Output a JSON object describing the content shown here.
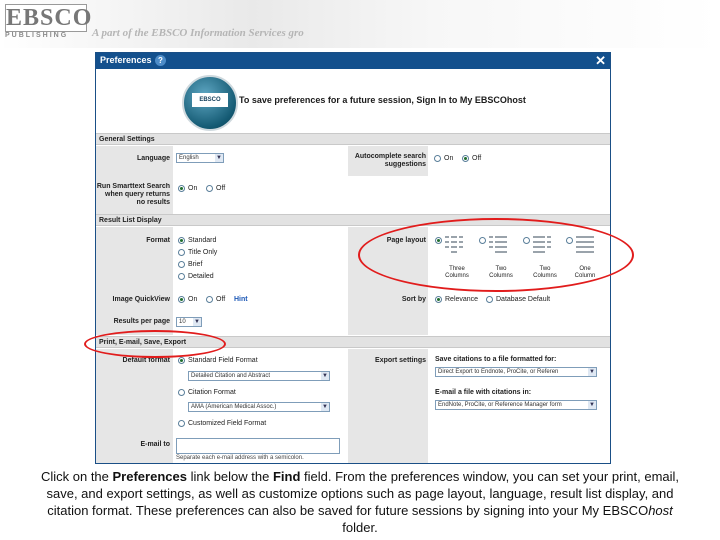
{
  "banner": {
    "logo_text": "EBSCO",
    "logo_sub": "PUBLISHING",
    "tagline": "A part of the EBSCO Information Services gro"
  },
  "dialog": {
    "title": "Preferences",
    "help_icon": "?",
    "close_icon": "✕",
    "signin": {
      "seal_text": "EBSCO",
      "text": "To save preferences for a future session, Sign In to My EBSCOhost"
    },
    "general": {
      "header": "General Settings",
      "language_label": "Language",
      "language_value": "English",
      "autocomplete_label": "Autocomplete search suggestions",
      "autocomplete_on": "On",
      "autocomplete_off": "Off",
      "smarttext_label": "Run Smarttext Search when query returns no results",
      "smarttext_on": "On",
      "smarttext_off": "Off"
    },
    "result_list": {
      "header": "Result List Display",
      "format_label": "Format",
      "formats": [
        "Standard",
        "Title Only",
        "Brief",
        "Detailed"
      ],
      "page_layout_label": "Page layout",
      "layouts": [
        "Three Columns",
        "Two Columns",
        "Two Columns",
        "One Column"
      ],
      "quickview_label": "Image QuickView",
      "quickview_on": "On",
      "quickview_off": "Off",
      "hint": "Hint",
      "sortby_label": "Sort by",
      "sort_relevance": "Relevance",
      "sort_default": "Database Default",
      "results_label": "Results per page",
      "results_value": "10"
    },
    "export": {
      "header": "Print, E-mail, Save, Export",
      "default_format_label": "Default format",
      "standard_field": "Standard Field Format",
      "detailed_option": "Detailed Citation and Abstract",
      "citation_format": "Citation Format",
      "citation_option": "AMA (American Medical Assoc.)",
      "customized": "Customized Field Format",
      "export_settings_label": "Export settings",
      "save_citations": "Save citations to a file formatted for:",
      "save_option": "Direct Export to Endnote, ProCite, or Referen",
      "email_file": "E-mail a file with citations in:",
      "email_option": "EndNote, ProCite, or Reference Manager form",
      "email_to_label": "E-mail to",
      "email_note": "Separate each e-mail address with a semicolon."
    }
  },
  "caption": {
    "p1": "Click on the ",
    "p1_bold": "Preferences",
    "p2": " link below the ",
    "p2_bold": "Find",
    "p3": " field. From the preferences window, you can set your print, email, save, and export settings, as well as customize options such as page layout, language, result list display, and citation format. These preferences can also be saved for future sessions by signing into your My EBSCO",
    "p3_italic": "host",
    "p4": " folder."
  },
  "colors": {
    "titlebar": "#13508d",
    "highlight": "#e11c1c",
    "section": "#e2e2e2"
  }
}
